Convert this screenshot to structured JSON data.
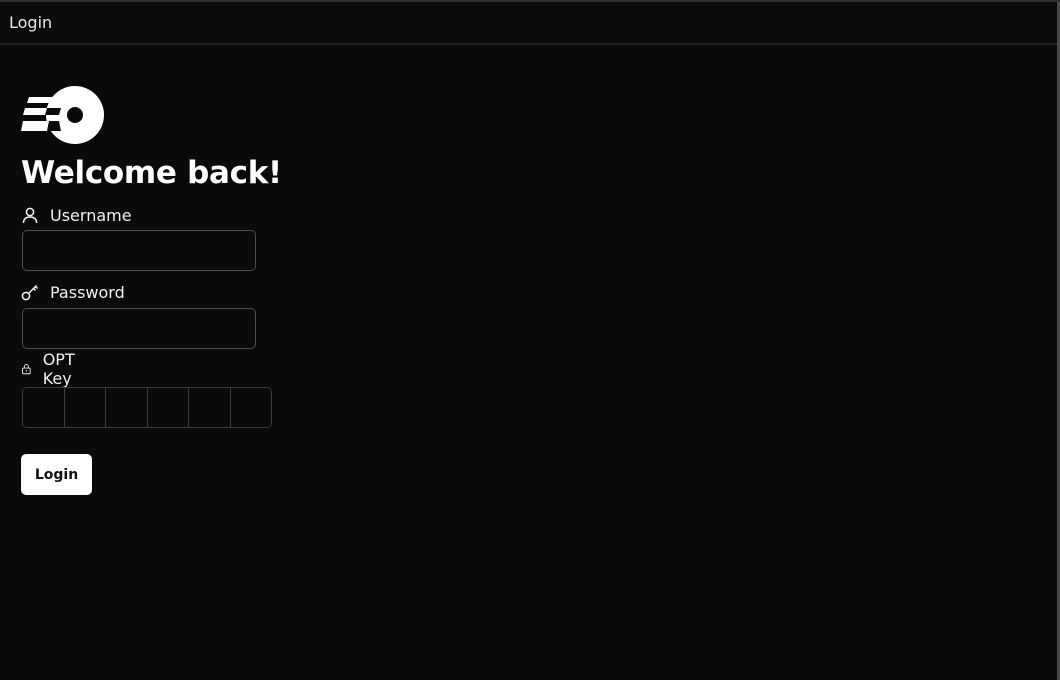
{
  "window": {
    "title": "Login"
  },
  "brand": {
    "logo_icon": "brand-disc-speed-icon"
  },
  "form": {
    "heading": "Welcome back!",
    "username": {
      "label": "Username",
      "icon": "user-icon",
      "value": "",
      "placeholder": ""
    },
    "password": {
      "label": "Password",
      "icon": "key-icon",
      "value": "",
      "placeholder": ""
    },
    "otp": {
      "label": "OPT Key",
      "icon": "lock-icon",
      "digits": [
        "",
        "",
        "",
        "",
        "",
        ""
      ]
    },
    "submit_label": "Login"
  },
  "colors": {
    "background": "#0a0a0c",
    "text": "#ffffff",
    "input_border": "#4b4c50",
    "button_bg": "#ffffff",
    "button_text": "#111111"
  }
}
